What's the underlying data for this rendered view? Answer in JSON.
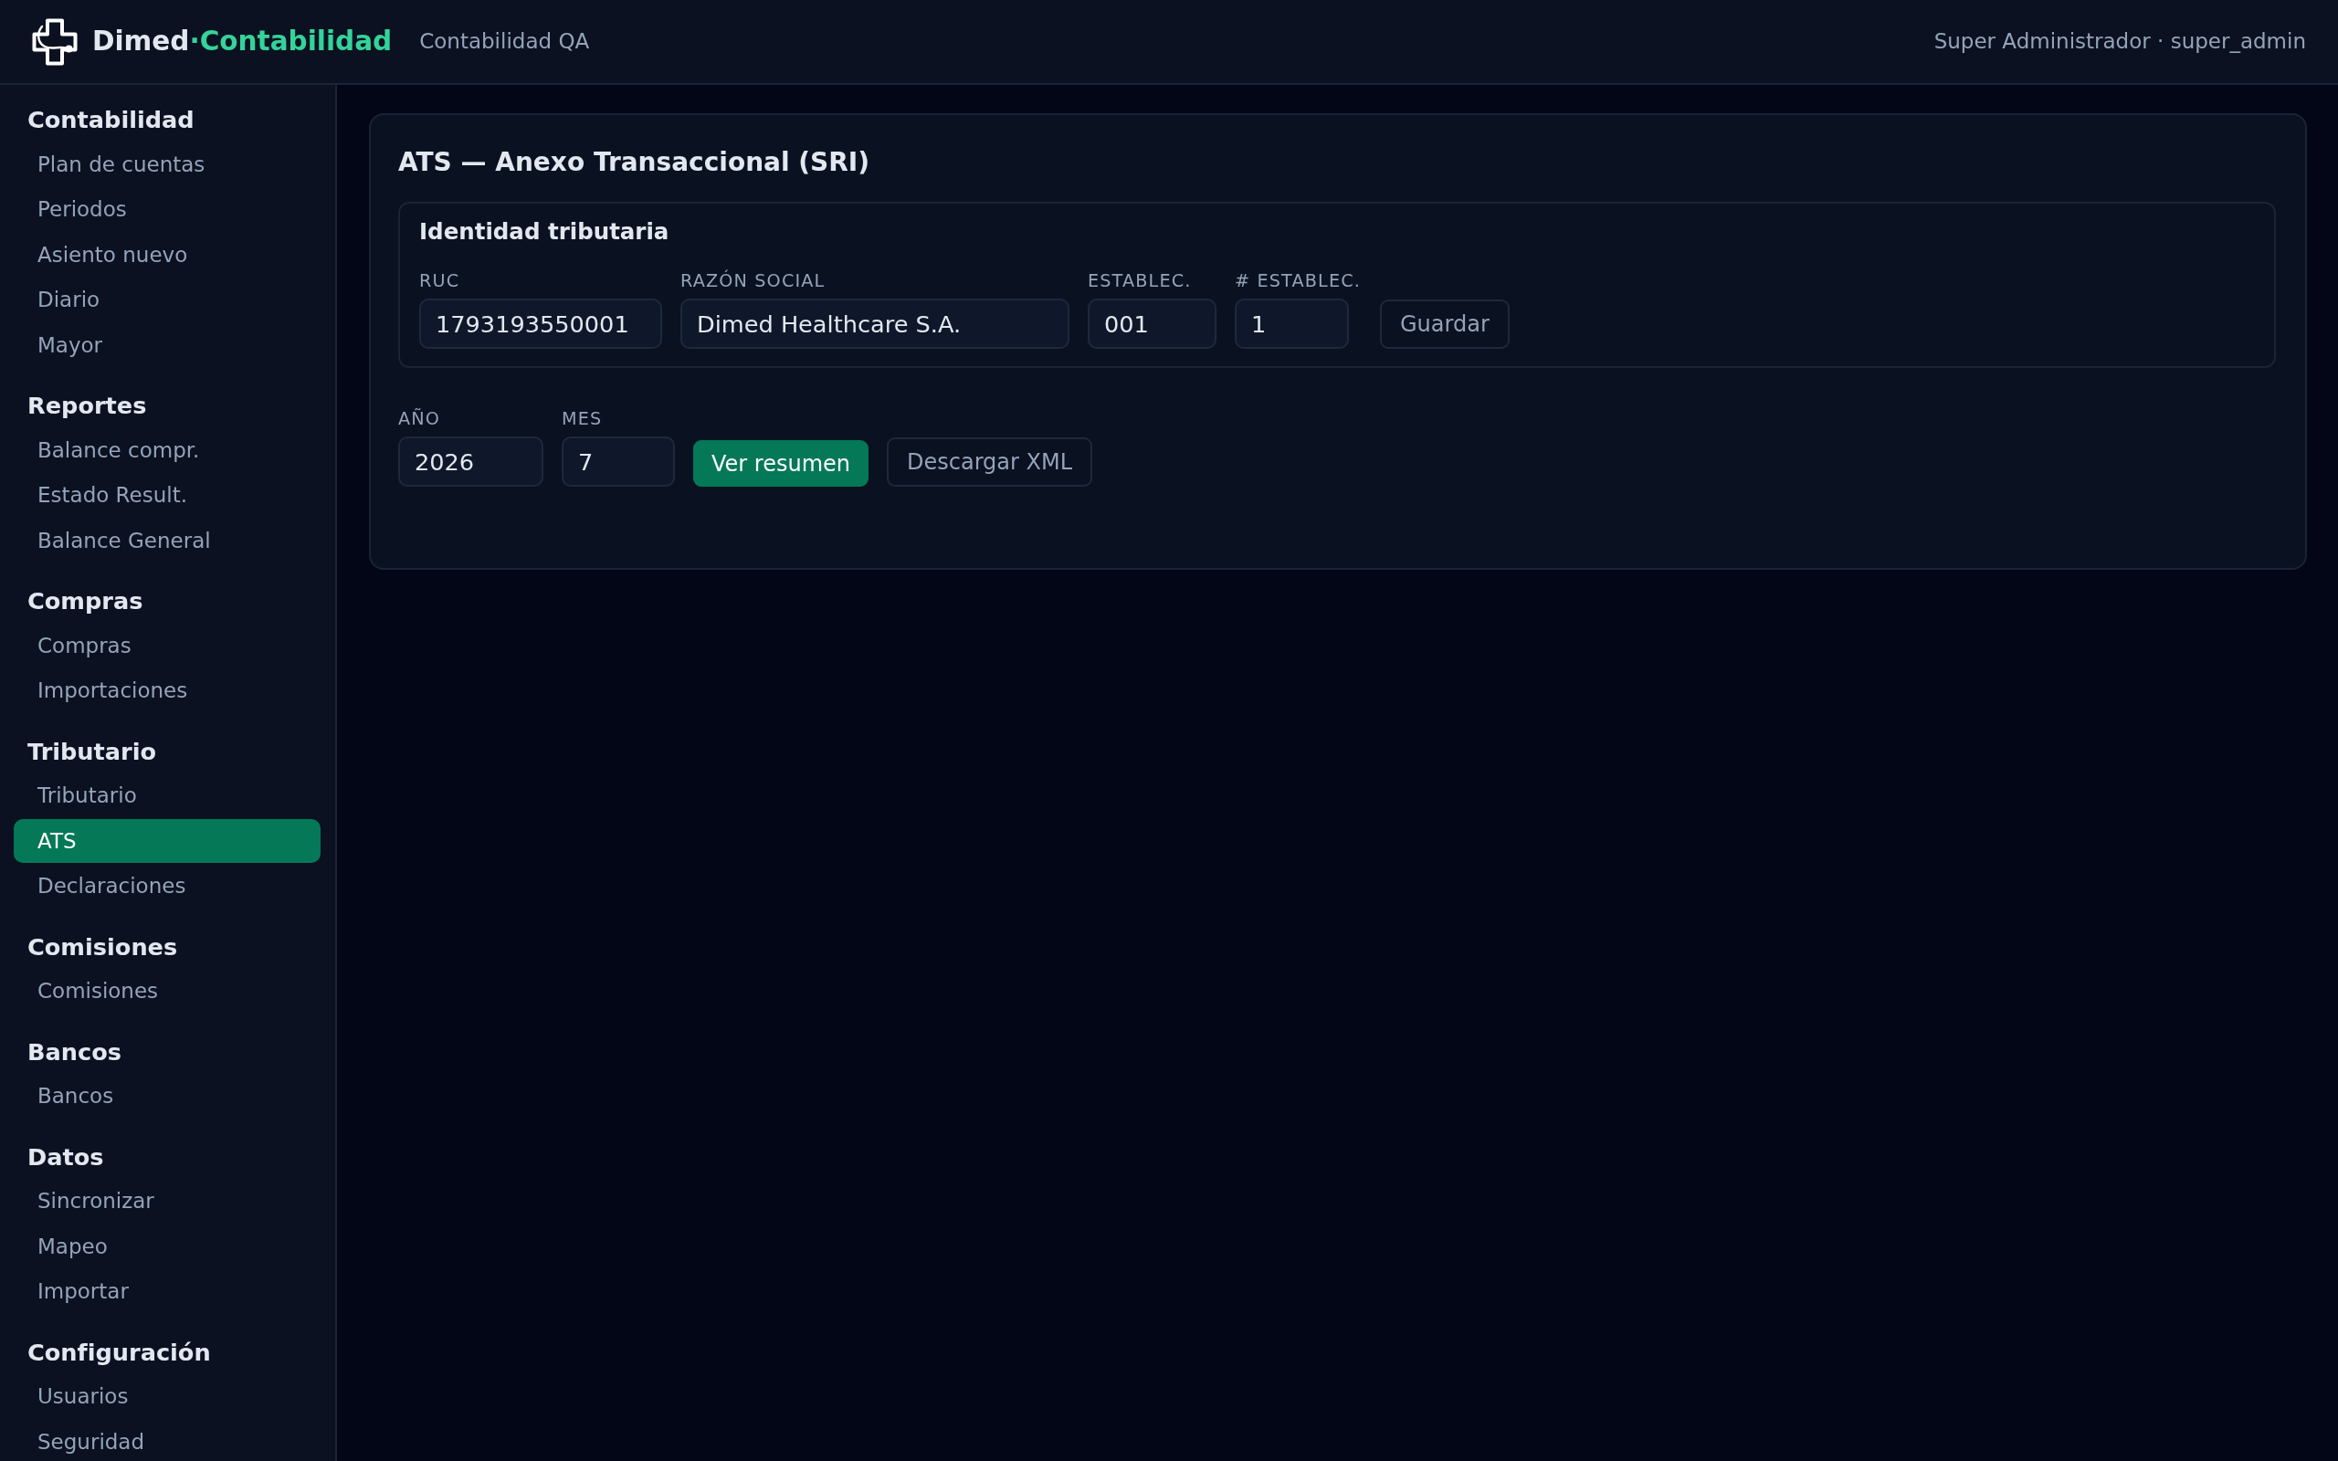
{
  "header": {
    "brand": {
      "name": "Dimed",
      "product": "·Contabilidad"
    },
    "environment": "Contabilidad QA",
    "user": "Super Administrador · super_admin"
  },
  "sidebar": {
    "sections": [
      {
        "title": "Contabilidad",
        "items": [
          {
            "label": "Plan de cuentas",
            "selected": false
          },
          {
            "label": "Periodos",
            "selected": false
          },
          {
            "label": "Asiento nuevo",
            "selected": false
          },
          {
            "label": "Diario",
            "selected": false
          },
          {
            "label": "Mayor",
            "selected": false
          }
        ]
      },
      {
        "title": "Reportes",
        "items": [
          {
            "label": "Balance compr.",
            "selected": false
          },
          {
            "label": "Estado Result.",
            "selected": false
          },
          {
            "label": "Balance General",
            "selected": false
          }
        ]
      },
      {
        "title": "Compras",
        "items": [
          {
            "label": "Compras",
            "selected": false
          },
          {
            "label": "Importaciones",
            "selected": false
          }
        ]
      },
      {
        "title": "Tributario",
        "items": [
          {
            "label": "Tributario",
            "selected": false
          },
          {
            "label": "ATS",
            "selected": true
          },
          {
            "label": "Declaraciones",
            "selected": false
          }
        ]
      },
      {
        "title": "Comisiones",
        "items": [
          {
            "label": "Comisiones",
            "selected": false
          }
        ]
      },
      {
        "title": "Bancos",
        "items": [
          {
            "label": "Bancos",
            "selected": false
          }
        ]
      },
      {
        "title": "Datos",
        "items": [
          {
            "label": "Sincronizar",
            "selected": false
          },
          {
            "label": "Mapeo",
            "selected": false
          },
          {
            "label": "Importar",
            "selected": false
          }
        ]
      },
      {
        "title": "Configuración",
        "items": [
          {
            "label": "Usuarios",
            "selected": false
          },
          {
            "label": "Seguridad",
            "selected": false
          }
        ]
      }
    ]
  },
  "page": {
    "title": "ATS — Anexo Transaccional (SRI)",
    "identity": {
      "title": "Identidad tributaria",
      "fields": [
        {
          "label": "RUC",
          "value": "1793193550001"
        },
        {
          "label": "RAZÓN SOCIAL",
          "value": "Dimed Healthcare S.A."
        },
        {
          "label": "ESTABLEC.",
          "value": "001"
        },
        {
          "label": "# ESTABLEC.",
          "value": "1"
        }
      ],
      "buttons": [
        {
          "label": "Guardar",
          "kind": "outline"
        }
      ]
    },
    "period": {
      "fields": [
        {
          "label": "AÑO",
          "value": "2026"
        },
        {
          "label": "MES",
          "value": "7"
        }
      ],
      "buttons": [
        {
          "label": "Ver resumen",
          "kind": "primary"
        },
        {
          "label": "Descargar XML",
          "kind": "outline"
        }
      ]
    }
  }
}
